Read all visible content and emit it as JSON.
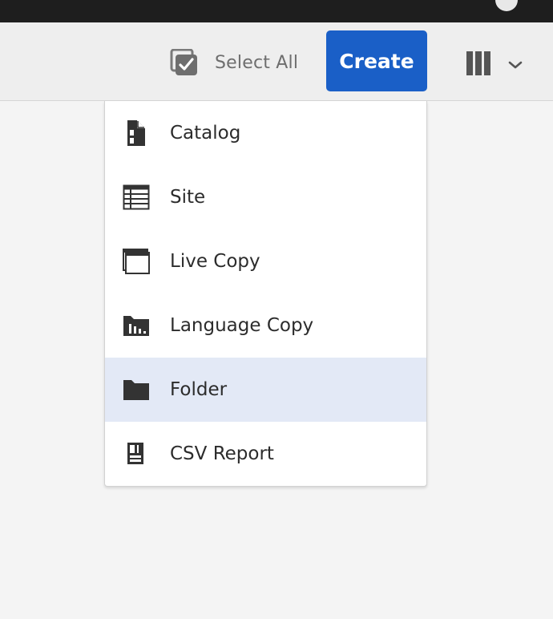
{
  "toolbar": {
    "select_all_label": "Select All",
    "select_all_icon": "select-all-icon",
    "create_label": "Create",
    "view_switcher_icon": "column-view-icon",
    "view_switcher_dropdown_icon": "chevron-down-icon"
  },
  "create_menu": {
    "items": [
      {
        "label": "Catalog",
        "icon": "catalog-icon"
      },
      {
        "label": "Site",
        "icon": "site-icon"
      },
      {
        "label": "Live Copy",
        "icon": "live-copy-icon"
      },
      {
        "label": "Language Copy",
        "icon": "language-copy-icon"
      },
      {
        "label": "Folder",
        "icon": "folder-icon"
      },
      {
        "label": "CSV Report",
        "icon": "csv-report-icon"
      }
    ],
    "selected": "Folder"
  },
  "colors": {
    "create_button": "#1a5fc7",
    "selected_item_bg": "#e3e9f6",
    "top_bar": "#1e1e1e",
    "action_bar": "#eeeeee"
  }
}
